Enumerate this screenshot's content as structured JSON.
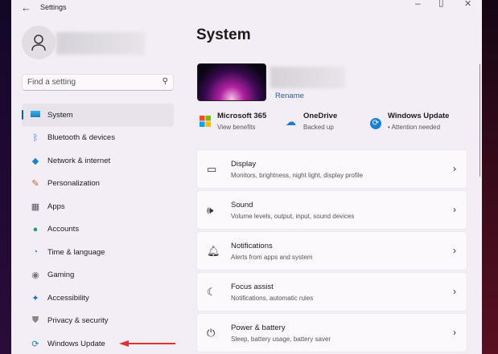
{
  "window": {
    "title": "Settings",
    "controls": [
      "minimize",
      "maximize",
      "close"
    ]
  },
  "search": {
    "placeholder": "Find a setting"
  },
  "sidebar": {
    "items": [
      {
        "label": "System",
        "icon": "monitor-icon",
        "selected": true
      },
      {
        "label": "Bluetooth & devices",
        "icon": "bluetooth-icon"
      },
      {
        "label": "Network & internet",
        "icon": "wifi-icon"
      },
      {
        "label": "Personalization",
        "icon": "brush-icon"
      },
      {
        "label": "Apps",
        "icon": "apps-icon"
      },
      {
        "label": "Accounts",
        "icon": "person-icon"
      },
      {
        "label": "Time & language",
        "icon": "globe-clock-icon"
      },
      {
        "label": "Gaming",
        "icon": "controller-icon"
      },
      {
        "label": "Accessibility",
        "icon": "accessibility-icon"
      },
      {
        "label": "Privacy & security",
        "icon": "shield-icon"
      },
      {
        "label": "Windows Update",
        "icon": "update-icon"
      }
    ]
  },
  "main": {
    "title": "System",
    "rename": "Rename",
    "quick": [
      {
        "title": "Microsoft 365",
        "sub": "View benefits"
      },
      {
        "title": "OneDrive",
        "sub": "Backed up"
      },
      {
        "title": "Windows Update",
        "sub": "• Attention needed"
      }
    ],
    "cards": [
      {
        "title": "Display",
        "sub": "Monitors, brightness, night light, display profile"
      },
      {
        "title": "Sound",
        "sub": "Volume levels, output, input, sound devices"
      },
      {
        "title": "Notifications",
        "sub": "Alerts from apps and system"
      },
      {
        "title": "Focus assist",
        "sub": "Notifications, automatic rules"
      },
      {
        "title": "Power & battery",
        "sub": "Sleep, battery usage, battery saver"
      }
    ]
  },
  "colors": {
    "accent": "#0067c0",
    "arrow": "#e03030"
  }
}
